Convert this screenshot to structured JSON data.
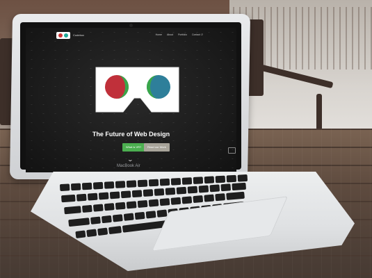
{
  "device": {
    "model_label": "MacBook Air"
  },
  "website": {
    "brand": "Codebox",
    "nav_links": [
      "Home",
      "About",
      "Portfolio",
      "Contact"
    ],
    "hero_title": "The Future of Web Design",
    "primary_button": "What is VR?",
    "secondary_button": "Read our Work",
    "colors": {
      "accent_green": "#4caf50",
      "lens_red": "#c0303a",
      "lens_green": "#39a64a",
      "lens_teal": "#2e7f9a",
      "secondary_button": "#a8a49a"
    }
  },
  "icons": [
    "search-icon",
    "chevron-down-icon",
    "chat-icon",
    "vr-logo-icon"
  ]
}
